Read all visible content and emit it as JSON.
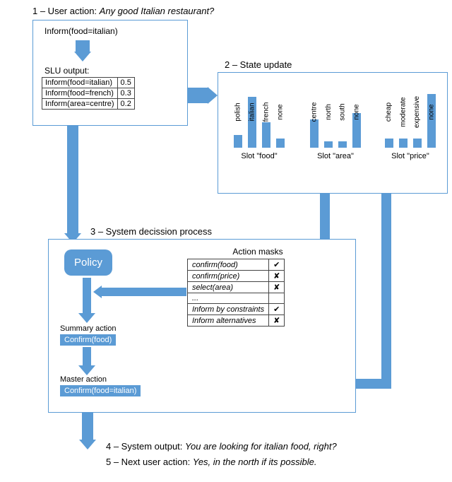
{
  "step1": {
    "label": "1 – User action:",
    "utterance": "Any good Italian restaurant?",
    "inform": "Inform(food=italian)",
    "slu_title": "SLU output:",
    "slu_rows": [
      {
        "hyp": "Inform(food=italian)",
        "p": "0.5"
      },
      {
        "hyp": "Inform(food=french)",
        "p": "0.3"
      },
      {
        "hyp": "Inform(area=centre)",
        "p": "0.2"
      }
    ]
  },
  "step2": {
    "label": "2 – State update",
    "slots": [
      {
        "title": "Slot \"food\"",
        "cats": [
          "polish",
          "italian",
          "french",
          "none"
        ],
        "vals": [
          20,
          80,
          40,
          15
        ]
      },
      {
        "title": "Slot \"area\"",
        "cats": [
          "centre",
          "north",
          "south",
          "none"
        ],
        "vals": [
          45,
          10,
          10,
          55
        ]
      },
      {
        "title": "Slot \"price\"",
        "cats": [
          "cheap",
          "moderate",
          "expensive",
          "none"
        ],
        "vals": [
          15,
          15,
          15,
          85
        ]
      }
    ]
  },
  "step3": {
    "label": "3 – System decission process",
    "policy": "Policy",
    "masks_title": "Action masks",
    "masks": [
      {
        "name": "confirm(food)",
        "ok": "✔"
      },
      {
        "name": "confirm(price)",
        "ok": "✘"
      },
      {
        "name": "select(area)",
        "ok": "✘"
      },
      {
        "name": "...",
        "ok": ""
      },
      {
        "name": "Inform by constraints",
        "ok": "✔"
      },
      {
        "name": "Inform alternatives",
        "ok": "✘"
      }
    ],
    "summary_lbl": "Summary action",
    "summary_val": "Confirm(food)",
    "master_lbl": "Master action",
    "master_val": "Confirm(food=italian)"
  },
  "step4": {
    "label": "4 – System output:",
    "utterance": "You are looking for italian food, right?"
  },
  "step5": {
    "label": "5 – Next user action:",
    "utterance": "Yes, in the north if its possible."
  },
  "chart_data": [
    {
      "type": "bar",
      "title": "Slot \"food\"",
      "categories": [
        "polish",
        "italian",
        "french",
        "none"
      ],
      "values": [
        0.2,
        0.8,
        0.4,
        0.15
      ],
      "ylim": [
        0,
        1
      ]
    },
    {
      "type": "bar",
      "title": "Slot \"area\"",
      "categories": [
        "centre",
        "north",
        "south",
        "none"
      ],
      "values": [
        0.45,
        0.1,
        0.1,
        0.55
      ],
      "ylim": [
        0,
        1
      ]
    },
    {
      "type": "bar",
      "title": "Slot \"price\"",
      "categories": [
        "cheap",
        "moderate",
        "expensive",
        "none"
      ],
      "values": [
        0.15,
        0.15,
        0.15,
        0.85
      ],
      "ylim": [
        0,
        1
      ]
    }
  ]
}
